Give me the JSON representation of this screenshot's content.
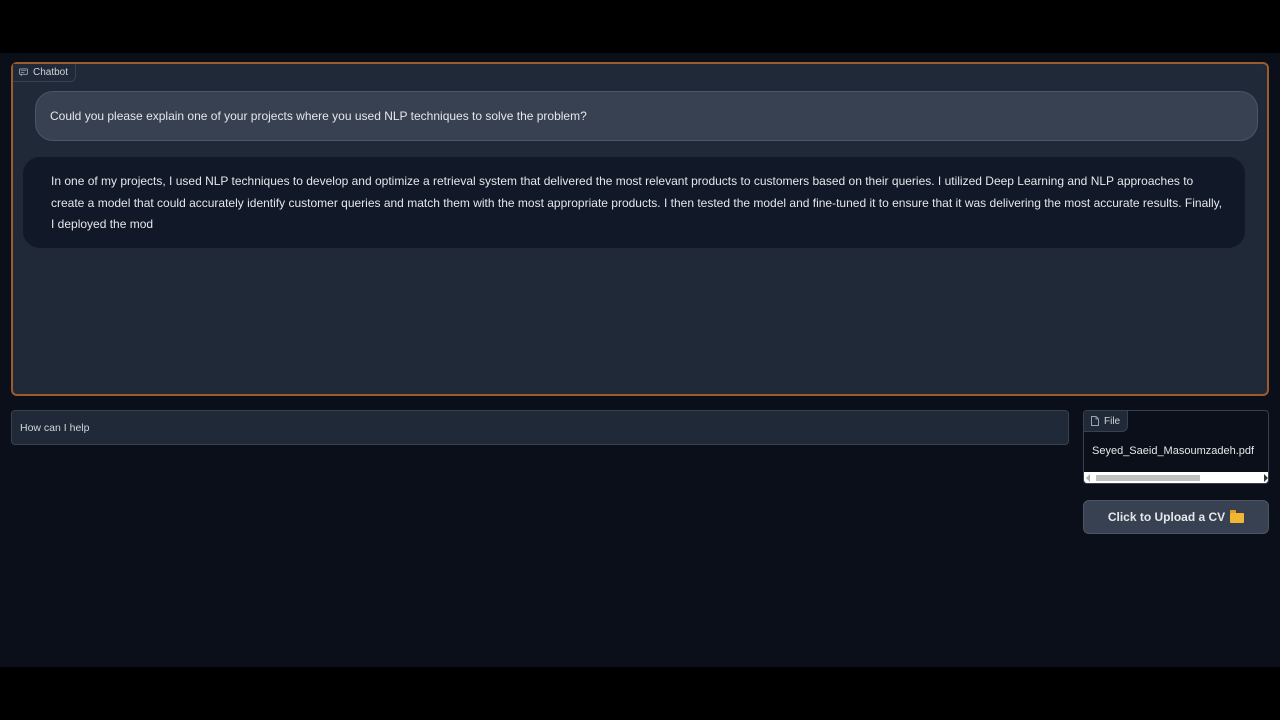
{
  "chatbot": {
    "label": "Chatbot",
    "messages": {
      "user": "Could you please explain one of your projects where you used NLP techniques to solve the problem?",
      "bot": "In one of my projects, I used NLP techniques to develop and optimize a retrieval system that delivered the most relevant products to customers based on their queries. I utilized Deep Learning and NLP approaches to create a model that could accurately identify customer queries and match them with the most appropriate products. I then tested the model and fine-tuned it to ensure that it was delivering the most accurate results. Finally, I deployed the mod"
    }
  },
  "input": {
    "placeholder": "How can I help",
    "value": ""
  },
  "file": {
    "label": "File",
    "filename": "Seyed_Saeid_Masoumzadeh.pdf"
  },
  "upload": {
    "label": "Click to Upload a CV",
    "icon": "folder-icon"
  },
  "colors": {
    "background": "#0b0f19",
    "panel": "#1f2937",
    "accent_border": "#9a5b2e"
  }
}
